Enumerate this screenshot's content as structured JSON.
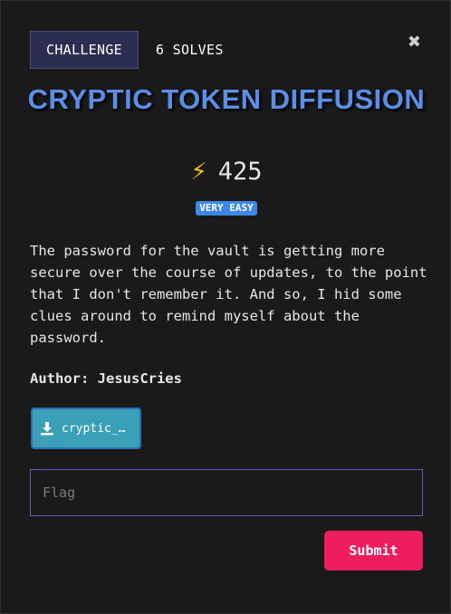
{
  "header": {
    "tab_challenge": "CHALLENGE",
    "tab_solves": "6 SOLVES",
    "close_symbol": "✖"
  },
  "challenge": {
    "title": "CRYPTIC TOKEN DIFFUSION",
    "points_icon": "⚡",
    "points": "425",
    "difficulty": "VERY EASY",
    "description": "The password for the vault is getting more secure over the course of updates, to the point that I don't remember it. And so, I hid some clues around to remind myself about the password.",
    "author": "Author: JesusCries",
    "file_label": "cryptic_…"
  },
  "form": {
    "flag_placeholder": "Flag",
    "submit_label": "Submit"
  },
  "colors": {
    "title": "#5d8ee6",
    "tab_bg": "#2b2d52",
    "difficulty_bg": "#3d87e6",
    "file_button_bg": "#3aa0b8",
    "submit_bg": "#ee1d5e",
    "bolt": "#f4c316"
  },
  "icons": {
    "close": "close-icon",
    "points": "lightning-bolt-icon",
    "download": "download-icon"
  }
}
